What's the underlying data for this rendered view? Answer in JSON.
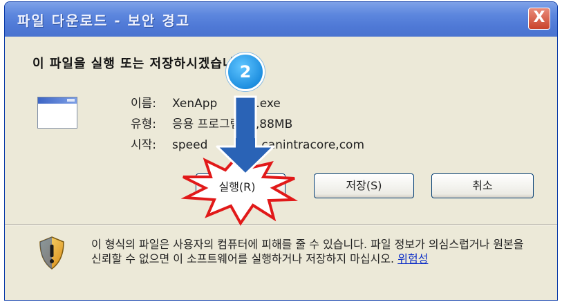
{
  "dialog": {
    "title": "파일 다운로드 - 보안 경고",
    "close_label": "X",
    "question": "이 파일을 실행 또는 저장하시겠습니까?",
    "file": {
      "name_label": "이름:",
      "name_value": "XenApp",
      "name_suffix": ".exe",
      "type_label": "유형:",
      "type_value": "응용 프로그램, 4,88MB",
      "source_label": "시작:",
      "source_value": "speed",
      "source_suffix": "canintracore,com"
    },
    "buttons": {
      "run": "실행(R)",
      "save": "저장(S)",
      "cancel": "취소"
    },
    "warning": {
      "text": "이 형식의 파일은 사용자의 컴퓨터에 피해를 줄 수 있습니다. 파일 정보가 의심스럽거나 원본을 신뢰할 수 없으면 이 소프트웨어를 실행하거나 저장하지 마십시오.",
      "link": "위험성"
    }
  },
  "annotation": {
    "step_number": "2"
  },
  "colors": {
    "titlebar": "#5d87de",
    "close_button": "#c9432b",
    "dialog_bg": "#ece9d8",
    "arrow": "#2a63b6",
    "starburst_fill": "#ffffff",
    "starburst_stroke": "#e11919",
    "step_badge": "#1e8fe0",
    "link": "#0a2cc7"
  }
}
